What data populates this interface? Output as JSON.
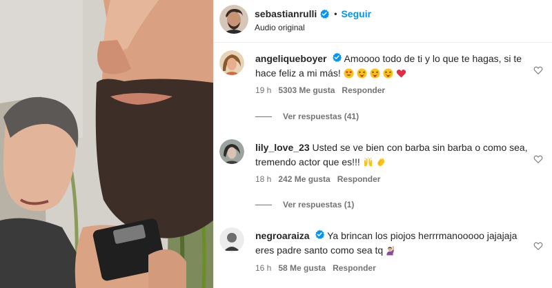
{
  "post": {
    "owner": "sebastianrulli",
    "separator": "•",
    "follow_label": "Seguir",
    "audio": "Audio original"
  },
  "comments": [
    {
      "user": "angeliqueboyer",
      "verified": true,
      "text_line1": "Amoooo todo de ti y lo que te hagas, si te",
      "text_line2": "hace feliz a mi más!",
      "emojis": [
        "smiling-face-with-heart-eyes",
        "face-with-tongue",
        "face-with-tongue",
        "face-with-tongue",
        "red-heart"
      ],
      "time": "19 h",
      "likes": "5303 Me gusta",
      "reply": "Responder",
      "view_replies": "Ver respuestas (41)"
    },
    {
      "user": "lily_love_23",
      "verified": false,
      "text_line1": "Usted se ve bien con barba sin barba o como sea,",
      "text_line2": "tremendo actor que es!!!",
      "emojis": [
        "raising-hands",
        "clapping-hands"
      ],
      "time": "18 h",
      "likes": "242 Me gusta",
      "reply": "Responder",
      "view_replies": "Ver respuestas (1)"
    },
    {
      "user": "negroaraiza",
      "verified": true,
      "text_line1": "Ya brincan los piojos herrrmanooooo jajajaja",
      "text_line2": "eres padre santo como sea tq",
      "emojis": [
        "person-raising-hand"
      ],
      "time": "16 h",
      "likes": "58 Me gusta",
      "reply": "Responder"
    }
  ],
  "colors": {
    "accent": "#0095f6",
    "text": "#262626",
    "secondary": "#737373",
    "divider": "#efefef"
  }
}
